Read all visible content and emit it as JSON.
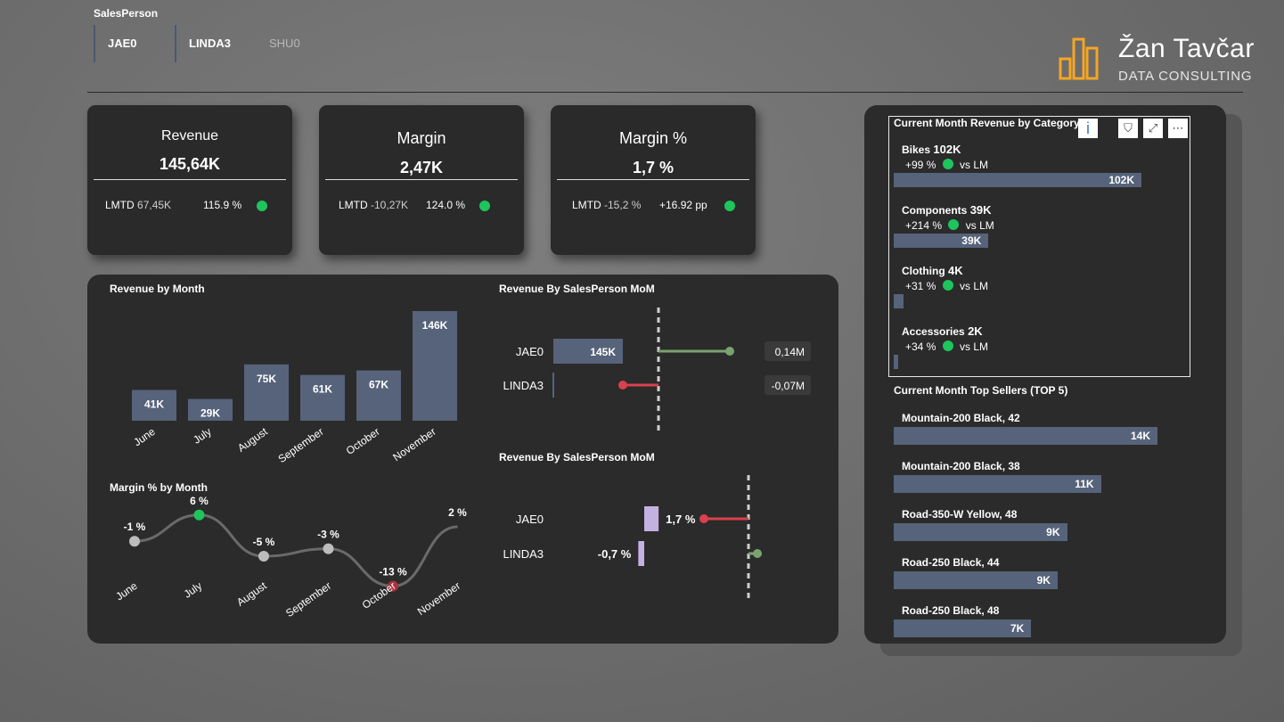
{
  "slicer": {
    "title": "SalesPerson",
    "items": [
      {
        "label": "JAE0",
        "selected": true
      },
      {
        "label": "LINDA3",
        "selected": true
      },
      {
        "label": "SHU0",
        "selected": false
      }
    ]
  },
  "logo": {
    "name": "Žan Tavčar",
    "subtitle": "DATA CONSULTING",
    "color": "#f5a623"
  },
  "kpis": [
    {
      "label": "Revenue",
      "value": "145,64K",
      "lmtd_label": "LMTD",
      "lmtd_value": "67,45K",
      "change": "115.9 %"
    },
    {
      "label": "Margin",
      "value": "2,47K",
      "lmtd_label": "LMTD",
      "lmtd_value": "-10,27K",
      "change": "124.0 %"
    },
    {
      "label": "Margin %",
      "value": "1,7 %",
      "lmtd_label": "LMTD",
      "lmtd_value": "-15,2 %",
      "change": "+16.92 pp"
    }
  ],
  "colors": {
    "bar": "#56637a",
    "positive": "#1ec45c",
    "negative": "#d9414e",
    "green_line": "#7aa36f",
    "purple": "#c3b1e1"
  },
  "revenue_by_month": {
    "title": "Revenue by Month",
    "chart_data": {
      "type": "bar",
      "categories": [
        "June",
        "July",
        "August",
        "September",
        "October",
        "November"
      ],
      "values": [
        41,
        29,
        75,
        61,
        67,
        146
      ],
      "labels": [
        "41K",
        "29K",
        "75K",
        "61K",
        "67K",
        "146K"
      ]
    }
  },
  "margin_by_month": {
    "title": "Margin % by Month",
    "chart_data": {
      "type": "line",
      "categories": [
        "June",
        "July",
        "August",
        "September",
        "October",
        "November"
      ],
      "values": [
        -1,
        6,
        -5,
        -3,
        -13,
        2
      ],
      "labels": [
        "-1 %",
        "6 %",
        "-5 %",
        "-3 %",
        "-13 %",
        "2 %"
      ]
    }
  },
  "rev_salesperson": {
    "title": "Revenue By SalesPerson MoM",
    "rows": [
      {
        "name": "JAE0",
        "bar_label": "145K",
        "value": 145,
        "delta_label": "0,14M",
        "delta": 0.14
      },
      {
        "name": "LINDA3",
        "bar_label": "",
        "value": 0,
        "delta_label": "-0,07M",
        "delta": -0.07
      }
    ]
  },
  "margin_salesperson": {
    "title": "Revenue By SalesPerson MoM",
    "rows": [
      {
        "name": "JAE0",
        "bar_label": "1,7 %",
        "value": 1.7,
        "delta": -5
      },
      {
        "name": "LINDA3",
        "bar_label": "-0,7 %",
        "value": -0.7,
        "delta": 1
      }
    ]
  },
  "category_panel": {
    "title": "Current Month Revenue by Category",
    "toolbar": {
      "info": "i",
      "filter": "⛉",
      "expand": "⤢",
      "more": "⋯"
    },
    "vs_label": "vs LM",
    "items": [
      {
        "name": "Bikes",
        "value_label": "102K",
        "value": 102,
        "change": "+99 %"
      },
      {
        "name": "Components",
        "value_label": "39K",
        "value": 39,
        "change": "+214 %"
      },
      {
        "name": "Clothing",
        "value_label": "4K",
        "value": 4,
        "change": "+31 %"
      },
      {
        "name": "Accessories",
        "value_label": "2K",
        "value": 2,
        "change": "+34 %"
      }
    ]
  },
  "top_sellers": {
    "title": "Current Month Top Sellers (TOP 5)",
    "items": [
      {
        "name": "Mountain-200 Black, 42",
        "value_label": "14K",
        "value": 14
      },
      {
        "name": "Mountain-200 Black, 38",
        "value_label": "11K",
        "value": 11
      },
      {
        "name": "Road-350-W Yellow, 48",
        "value_label": "9K",
        "value": 9.2
      },
      {
        "name": "Road-250 Black, 44",
        "value_label": "9K",
        "value": 8.7
      },
      {
        "name": "Road-250 Black, 48",
        "value_label": "7K",
        "value": 7.3
      }
    ]
  }
}
